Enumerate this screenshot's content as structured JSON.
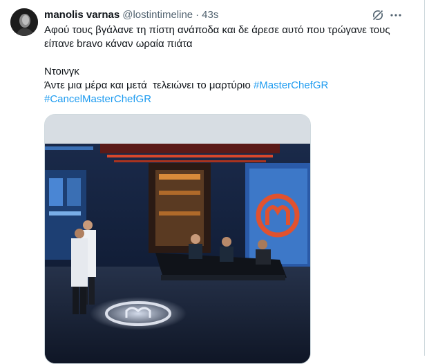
{
  "tweet": {
    "display_name": "manolis varnas",
    "handle": "@lostintimeline",
    "separator": "·",
    "time": "43s",
    "text_line1": "Αφού τους βγάλανε τη πίστη ανάποδα και δε άρεσε αυτό που τρώγανε τους",
    "text_line2": "είπανε bravo κάναν ωραία πιάτα",
    "text_line3": "Ντοινγκ",
    "text_line4_prefix": "Άντε μια μέρα και μετά  τελειώνει το μαρτύριο ",
    "hashtag1": "#MasterChefGR",
    "hashtag2": "#CancelMasterChefGR"
  },
  "icons": {
    "grok": "grok-icon",
    "more": "more-dots-icon"
  },
  "colors": {
    "link": "#1d9bf0",
    "secondary_text": "#536471",
    "border": "#cfd9de"
  }
}
